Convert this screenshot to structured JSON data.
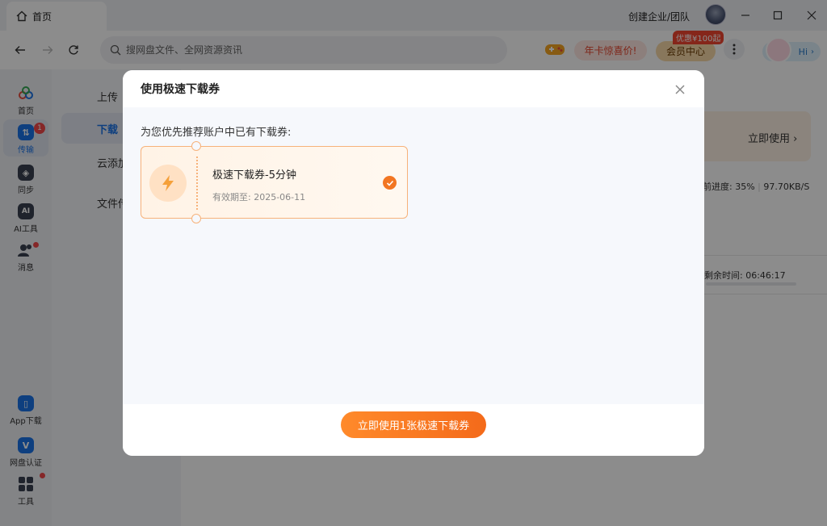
{
  "titlebar": {
    "home_tab": "首页",
    "create_team": "创建企业/团队"
  },
  "toolbar": {
    "search_placeholder": "搜网盘文件、全网资源资讯",
    "promo_label": "年卡惊喜价!",
    "vip_badge": "优惠¥100起",
    "vip_label": "会员中心",
    "hi_label": "Hi"
  },
  "sidebar": {
    "items": [
      {
        "label": "首页",
        "icon": "cloud-icon"
      },
      {
        "label": "传输",
        "icon": "transfer-icon",
        "badge": "1"
      },
      {
        "label": "同步",
        "icon": "sync-icon"
      },
      {
        "label": "AI工具",
        "icon": "ai-icon"
      },
      {
        "label": "消息",
        "icon": "message-icon"
      }
    ],
    "bottom_items": [
      {
        "label": "App下载",
        "icon": "phone-icon"
      },
      {
        "label": "网盘认证",
        "icon": "verify-icon"
      },
      {
        "label": "工具",
        "icon": "grid-icon"
      }
    ]
  },
  "subnav": {
    "items": [
      "上传",
      "下载",
      "云添加",
      "文件传"
    ]
  },
  "main": {
    "use_now": "立即使用",
    "progress": "前进度: 35%",
    "speed": "97.70KB/S",
    "remain": "剩余时间: 06:46:17"
  },
  "modal": {
    "title": "使用极速下载券",
    "subtitle": "为您优先推荐账户中已有下载券:",
    "coupon": {
      "title": "极速下载券-5分钟",
      "expiry": "有效期至: 2025-06-11"
    },
    "cta": "立即使用1张极速下载券"
  },
  "colors": {
    "accent": "#1a73e8",
    "orange": "#f27622",
    "badge_red": "#f2474a"
  }
}
